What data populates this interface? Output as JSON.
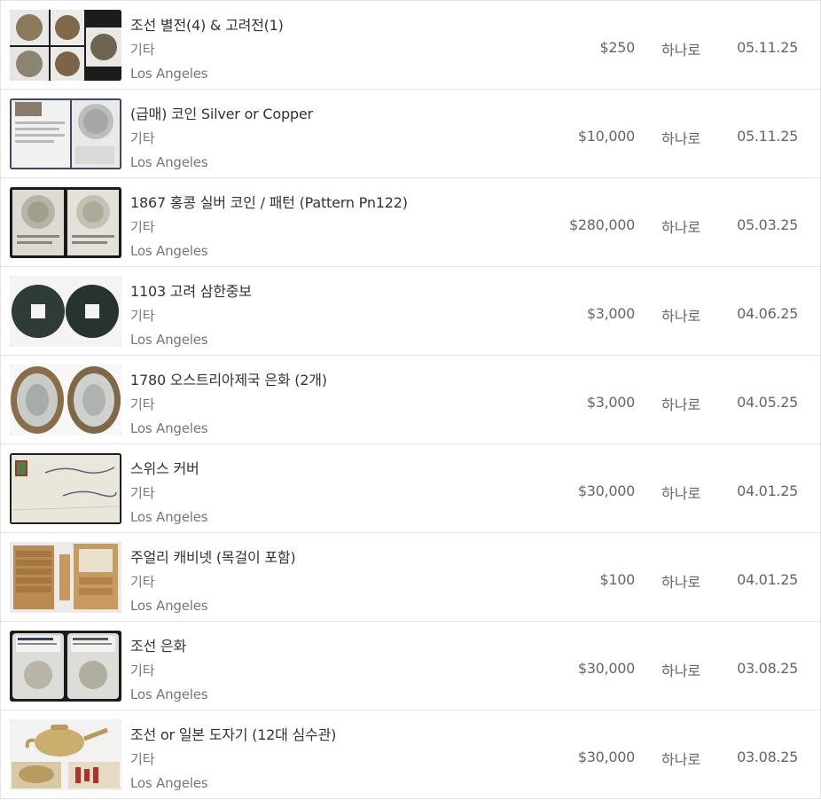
{
  "listings": [
    {
      "title": "조선 별전(4) & 고려전(1)",
      "category": "기타",
      "location": "Los Angeles",
      "price": "$250",
      "seller": "하나로",
      "date": "05.11.25",
      "thumbnail": "five-coins-photo"
    },
    {
      "title": "(급매) 코인 Silver or Copper",
      "category": "기타",
      "location": "Los Angeles",
      "price": "$10,000",
      "seller": "하나로",
      "date": "05.11.25",
      "thumbnail": "coin-certificate-photo"
    },
    {
      "title": "1867 홍콩 실버 코인 / 패턴 (Pattern Pn122)",
      "category": "기타",
      "location": "Los Angeles",
      "price": "$280,000",
      "seller": "하나로",
      "date": "05.03.25",
      "thumbnail": "silver-coins-album-photo"
    },
    {
      "title": "1103 고려 삼한중보",
      "category": "기타",
      "location": "Los Angeles",
      "price": "$3,000",
      "seller": "하나로",
      "date": "04.06.25",
      "thumbnail": "square-hole-coins-photo"
    },
    {
      "title": "1780 오스트리아제국 은화 (2개)",
      "category": "기타",
      "location": "Los Angeles",
      "price": "$3,000",
      "seller": "하나로",
      "date": "04.05.25",
      "thumbnail": "toned-silver-coins-photo"
    },
    {
      "title": "스위스 커버",
      "category": "기타",
      "location": "Los Angeles",
      "price": "$30,000",
      "seller": "하나로",
      "date": "04.01.25",
      "thumbnail": "stamp-cover-photo"
    },
    {
      "title": "주얼리 캐비넷 (목걸이 포함)",
      "category": "기타",
      "location": "Los Angeles",
      "price": "$100",
      "seller": "하나로",
      "date": "04.01.25",
      "thumbnail": "jewelry-cabinet-photo"
    },
    {
      "title": "조선 은화",
      "category": "기타",
      "location": "Los Angeles",
      "price": "$30,000",
      "seller": "하나로",
      "date": "03.08.25",
      "thumbnail": "slabbed-coins-photo"
    },
    {
      "title": "조선 or 일본 도자기 (12대 심수관)",
      "category": "기타",
      "location": "Los Angeles",
      "price": "$30,000",
      "seller": "하나로",
      "date": "03.08.25",
      "thumbnail": "teapot-photo"
    }
  ]
}
